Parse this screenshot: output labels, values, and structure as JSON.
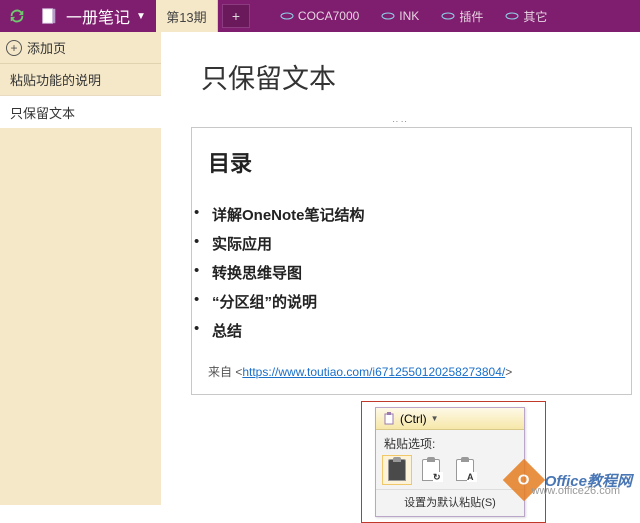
{
  "titlebar": {
    "notebook_name": "一册笔记"
  },
  "section_tab": {
    "label": "第13期",
    "add": "+"
  },
  "top_links": [
    "COCA7000",
    "INK",
    "插件",
    "其它"
  ],
  "sidebar": {
    "add_page": "添加页",
    "items": [
      {
        "label": "粘贴功能的说明",
        "active": false
      },
      {
        "label": "只保留文本",
        "active": true
      }
    ]
  },
  "page": {
    "title": "只保留文本",
    "toc_heading": "目录",
    "toc_items": [
      "详解OneNote笔记结构",
      "实际应用",
      "转换思维导图",
      "“分区组”的说明",
      "总结"
    ],
    "source_prefix": "来自 <",
    "source_url": "https://www.toutiao.com/i6712550120258273804/",
    "source_suffix": ">"
  },
  "paste_popover": {
    "ctrl_label": "(Ctrl)",
    "options_label": "粘贴选项:",
    "default_label": "设置为默认粘贴(S)"
  },
  "watermark": {
    "badge": "O",
    "text": "Office教程网",
    "sub": "www.office26.com"
  }
}
